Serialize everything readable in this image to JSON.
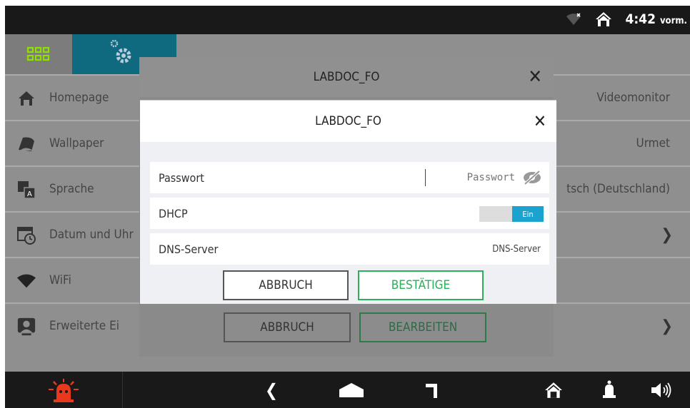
{
  "status_bar": {
    "time": "4:42",
    "ampm": "vorm.",
    "icons": [
      "wifi-off-icon",
      "home-icon"
    ]
  },
  "menu": {
    "items": [
      {
        "label": "Homepage",
        "value": "Videomonitor",
        "icon": "home-icon"
      },
      {
        "label": "Wallpaper",
        "value": "Urmet",
        "icon": "wallpaper-icon"
      },
      {
        "label": "Sprache",
        "value": "tsch (Deutschland)",
        "icon": "language-icon"
      },
      {
        "label": "Datum und Uhr",
        "value": "",
        "icon": "datetime-icon"
      },
      {
        "label": "WiFi",
        "value": "",
        "icon": "wifi-icon"
      },
      {
        "label": "Erweiterte Ei",
        "value": "",
        "icon": "advanced-settings-icon"
      }
    ]
  },
  "background_dialog": {
    "title": "LABDOC_FO",
    "cancel_label": "ABBRUCH",
    "edit_label": "BEARBEITEN"
  },
  "dialog": {
    "title": "LABDOC_FO",
    "password_label": "Passwort",
    "password_placeholder": "Passwort",
    "dhcp_label": "DHCP",
    "dhcp_state": "Ein",
    "dns_label": "DNS-Server",
    "dns_value": "DNS-Server",
    "cancel_label": "ABBRUCH",
    "confirm_label": "BESTÄTIGE"
  },
  "colors": {
    "accent_teal": "#0f6a7f",
    "toggle_on": "#1aa3cf",
    "confirm_green": "#2dae5a",
    "alarm_red": "#e8381e"
  }
}
